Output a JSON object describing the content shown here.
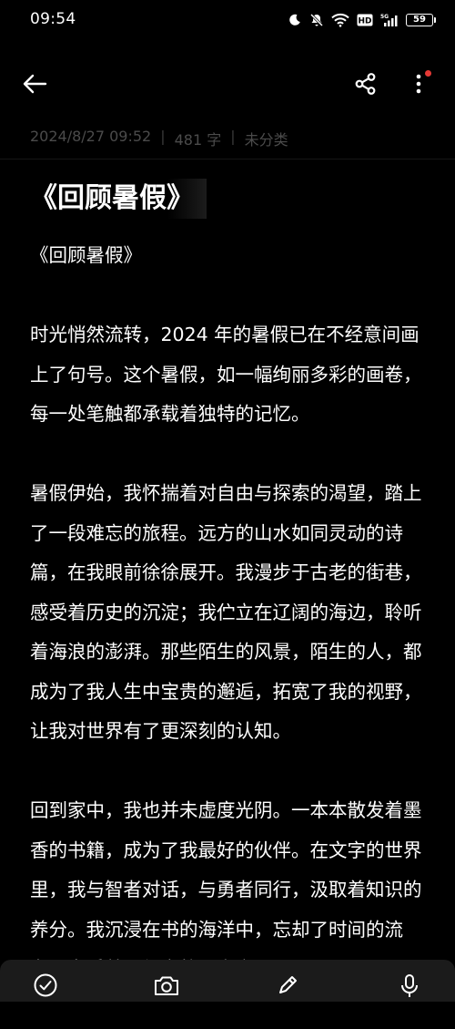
{
  "status_bar": {
    "time": "09:54",
    "network_label": "5G",
    "hd_label": "HD",
    "battery": "59"
  },
  "meta": {
    "datetime": "2024/8/27 09:52",
    "separator": "|",
    "word_count": "481 字",
    "category": "未分类"
  },
  "note": {
    "title": "《回顾暑假》",
    "paragraphs": [
      "《回顾暑假》",
      "时光悄然流转，2024 年的暑假已在不经意间画上了句号。这个暑假，如一幅绚丽多彩的画卷，每一处笔触都承载着独特的记忆。",
      "暑假伊始，我怀揣着对自由与探索的渴望，踏上了一段难忘的旅程。远方的山水如同灵动的诗篇，在我眼前徐徐展开。我漫步于古老的街巷，感受着历史的沉淀；我伫立在辽阔的海边，聆听着海浪的澎湃。那些陌生的风景，陌生的人，都成为了我人生中宝贵的邂逅，拓宽了我的视野，让我对世界有了更深刻的认知。",
      "回到家中，我也并未虚度光阴。一本本散发着墨香的书籍，成为了我最好的伙伴。在文字的世界里，我与智者对话，与勇者同行，汲取着知识的养分。我沉浸在书的海洋中，忘却了时间的流逝，享受着那份宁静与充实。"
    ]
  },
  "colors": {
    "background": "#000000",
    "text": "#ffffff",
    "meta_text": "#4b4b4b",
    "bottom_bar": "#1b1b1b",
    "badge_red": "#e53935"
  },
  "icons": {
    "back": "arrow-left-icon",
    "share": "share-icon",
    "more": "more-vertical-icon",
    "check": "check-circle-icon",
    "camera": "camera-icon",
    "pen": "pen-icon",
    "mic": "microphone-icon"
  }
}
